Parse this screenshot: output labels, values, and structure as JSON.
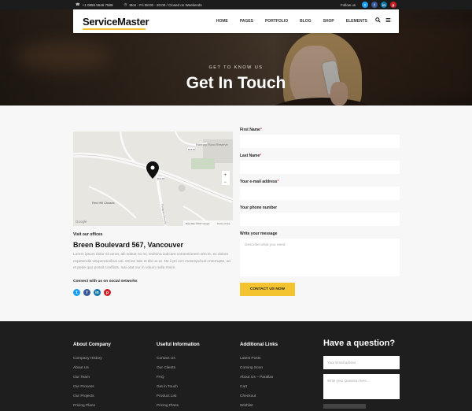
{
  "topbar": {
    "phone": "+1 0855 5646 7589",
    "hours": "Mon - Fri 08:00 - 20:00 / Closed on Weekends",
    "follow_label": "Follow us",
    "social": [
      {
        "icon": "twitter-icon",
        "glyph": "t",
        "color": "#1da1f2"
      },
      {
        "icon": "facebook-icon",
        "glyph": "f",
        "color": "#3b5998"
      },
      {
        "icon": "linkedin-icon",
        "glyph": "in",
        "color": "#0e76a8"
      },
      {
        "icon": "pinterest-icon",
        "glyph": "p",
        "color": "#cb2027"
      }
    ]
  },
  "nav": {
    "logo": "ServiceMaster",
    "menu": [
      "HOME",
      "PAGES",
      "PORTFOLIO",
      "BLOG",
      "SHOP",
      "ELEMENTS"
    ]
  },
  "hero": {
    "subtitle": "GET TO KNOW US",
    "title": "Get In Touch"
  },
  "map": {
    "place_label": "Hartney Road Reserve",
    "area_label": "Red Hill Chases",
    "road_label_1": "B3148",
    "road_label_2": "B3148",
    "street_label": "Thompson Drive Rd",
    "logo": "Google",
    "credits": "Map data ©2017 Google",
    "terms": "Terms of Use",
    "zoom_in": "+",
    "zoom_out": "−"
  },
  "office": {
    "visit_label": "Visit our offices",
    "address": "Breen Boulevard 567, Vancouver",
    "description": "Lorem ipsum dolor sit amet, alii soleat no mi. Dolnina iudicant contentionem elm te, ex dolore expetendis vituperatoribus usi. Omne tale et tibi us at. Ne ii pri veri meismpchum interrupte, an et pede quo possit conflicts. Iusi otat nur in volum nulla mnim.",
    "connect_label": "Connect with us on social networks"
  },
  "form": {
    "first_name_label": "First Name",
    "last_name_label": "Last Name",
    "email_label": "Your e-mail address",
    "phone_label": "Your phone number",
    "message_label": "Write your message",
    "message_placeholder": "Describe what you need",
    "submit_label": "CONTACT US NOW",
    "required_mark": "*"
  },
  "footer": {
    "about": {
      "heading": "About Company",
      "links": [
        "Company History",
        "About Us",
        "Our Team",
        "Our Process",
        "Our Projects",
        "Pricing Plans"
      ]
    },
    "useful": {
      "heading": "Useful Information",
      "links": [
        "Contact Us",
        "Our Clients",
        "FAQ",
        "Get in Touch",
        "Product List",
        "Pricing Plans"
      ]
    },
    "additional": {
      "heading": "Additional Links",
      "links": [
        "Latest Posts",
        "Coming Soon",
        "About Us – Parallax",
        "Cart",
        "Checkout",
        "Wishlist"
      ]
    },
    "question": {
      "heading": "Have a question?",
      "email_placeholder": "Your Email adress",
      "question_placeholder": "Write your Question here..."
    }
  }
}
